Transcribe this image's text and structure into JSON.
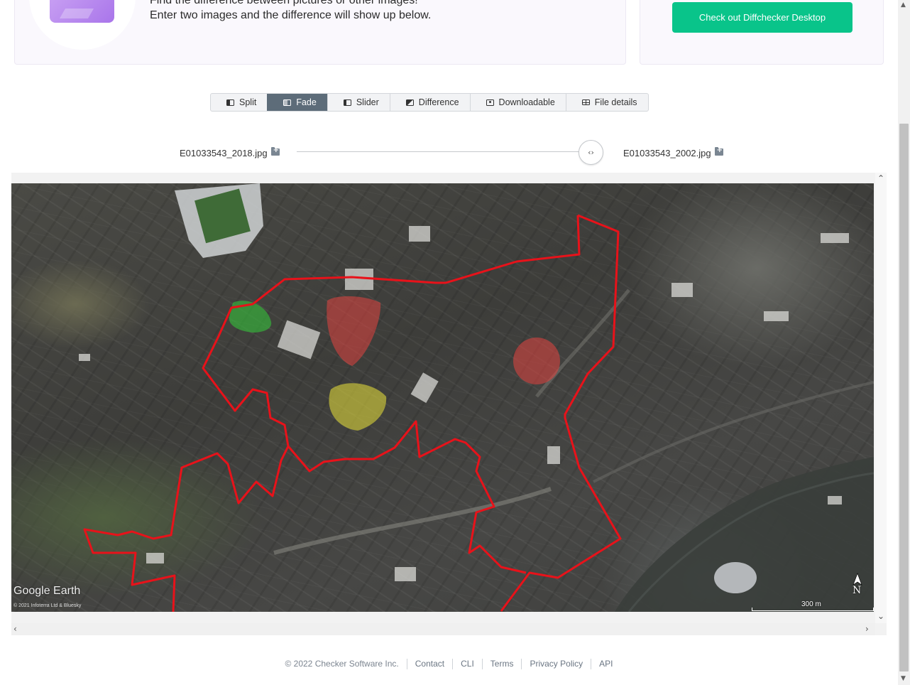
{
  "hero": {
    "line1": "Find the difference between pictures or other images!",
    "line2": "Enter two images and the difference will show up below."
  },
  "promo": {
    "button_label": "Check out Diffchecker Desktop"
  },
  "tabs": [
    {
      "label": "Split",
      "icon": "split-view-icon"
    },
    {
      "label": "Fade",
      "icon": "fade-view-icon",
      "active": true
    },
    {
      "label": "Slider",
      "icon": "slider-view-icon"
    },
    {
      "label": "Difference",
      "icon": "difference-view-icon"
    },
    {
      "label": "Downloadable",
      "icon": "camera-icon"
    },
    {
      "label": "File details",
      "icon": "table-icon"
    }
  ],
  "files": {
    "left": "E01033543_2018.jpg",
    "right": "E01033543_2002.jpg"
  },
  "fade_slider": {
    "value_fraction": 1.0,
    "handle_icon": "‹›"
  },
  "map": {
    "logo": "Google Earth",
    "copyright": "© 2021 Infoterra Ltd & Bluesky",
    "scale_label": "300 m",
    "north_label": "N",
    "highlight_colors": {
      "green": "#35c23a",
      "red": "#e2443f",
      "yellow": "#dcd63a",
      "outline": "#e8121a"
    }
  },
  "footer": {
    "copyright": "© 2022 Checker Software Inc.",
    "links": [
      "Contact",
      "CLI",
      "Terms",
      "Privacy Policy",
      "API"
    ]
  },
  "colors": {
    "accent": "#09c48a",
    "tab_active": "#5d6c79"
  }
}
